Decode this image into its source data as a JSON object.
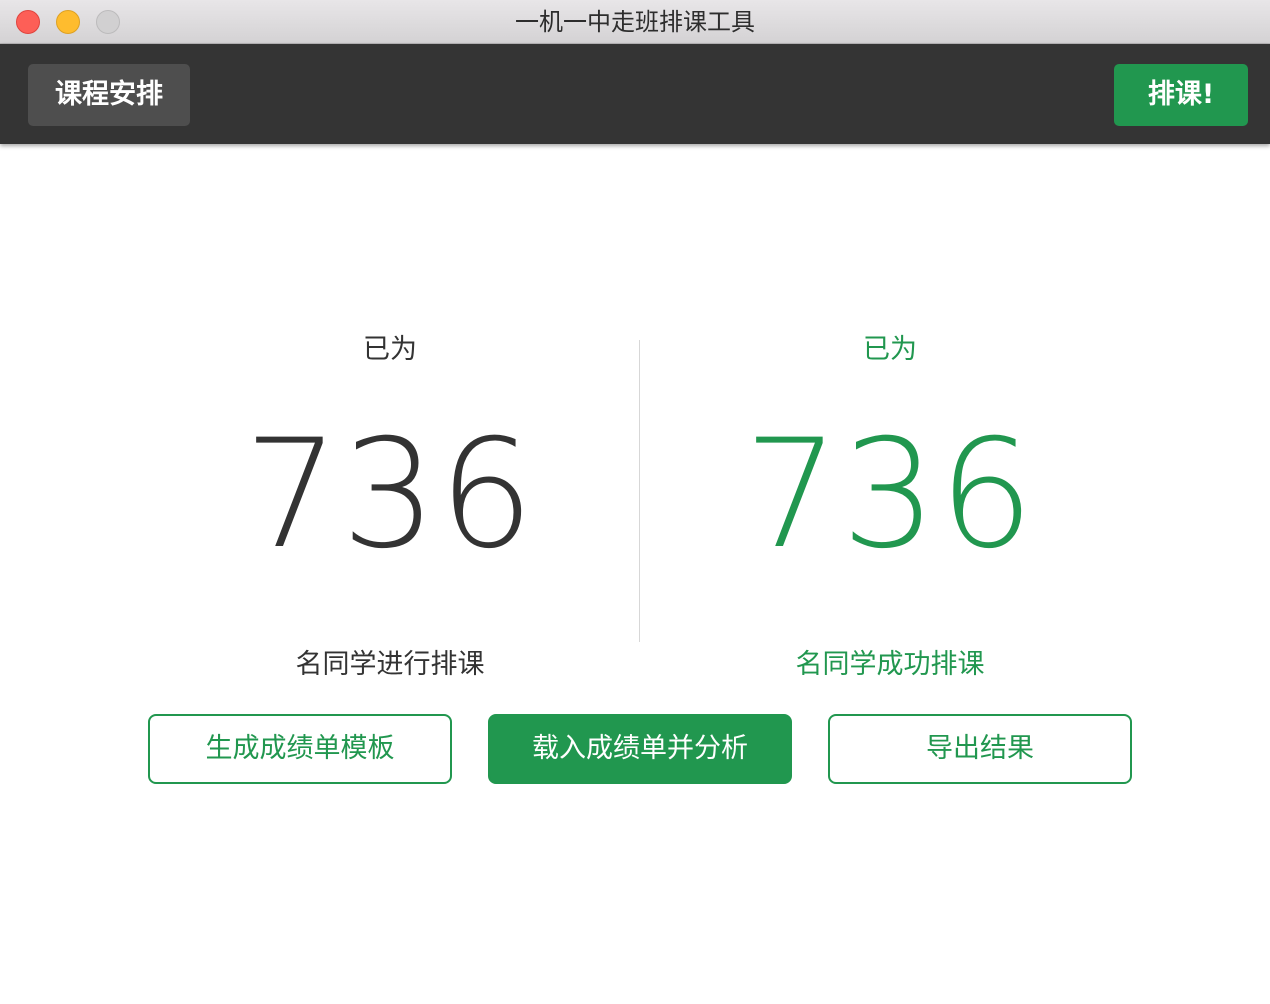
{
  "window": {
    "title": "一机一中走班排课工具"
  },
  "toolbar": {
    "nav_label": "课程安排",
    "schedule_label": "排课!"
  },
  "stats": {
    "left": {
      "prefix": "已为",
      "count": "736",
      "suffix": "名同学进行排课"
    },
    "right": {
      "prefix": "已为",
      "count": "736",
      "suffix": "名同学成功排课"
    }
  },
  "actions": {
    "generate_template": "生成成绩单模板",
    "load_and_analyze": "载入成绩单并分析",
    "export_results": "导出结果"
  },
  "colors": {
    "accent": "#21974f",
    "toolbar_bg": "#343434",
    "nav_button_bg": "#4e4e4e",
    "text_dark": "#333333"
  }
}
